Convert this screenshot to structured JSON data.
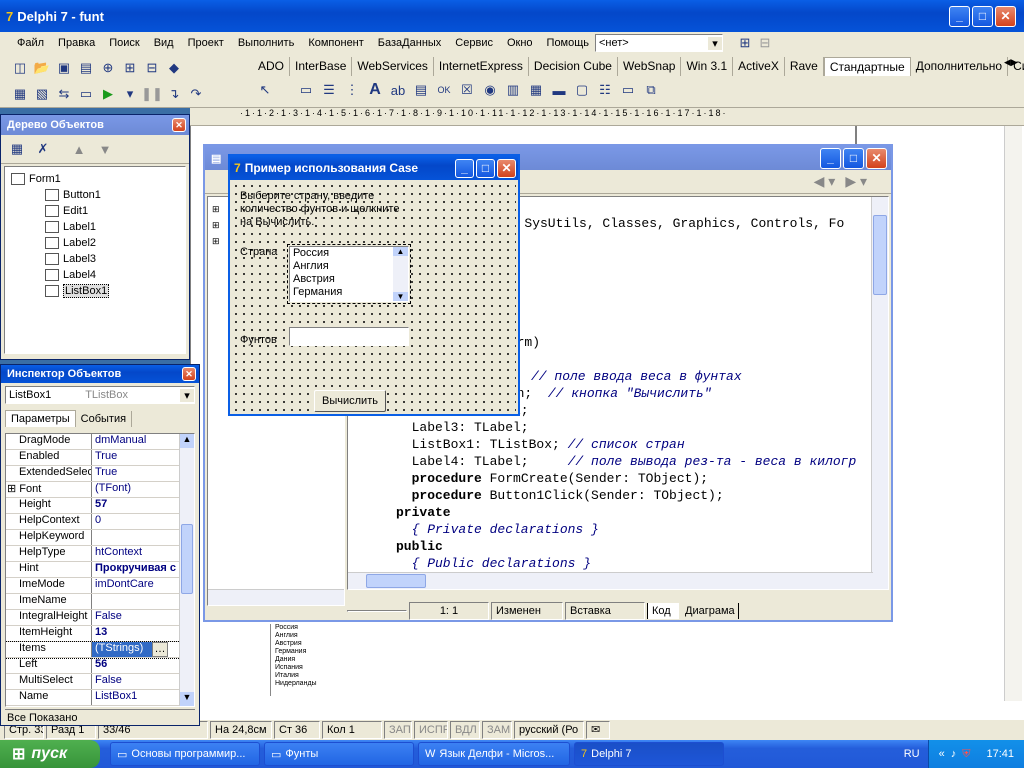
{
  "main_window": {
    "title": "Delphi 7 - funt"
  },
  "menu": [
    "Файл",
    "Правка",
    "Поиск",
    "Вид",
    "Проект",
    "Выполнить",
    "Компонент",
    "БазаДанных",
    "Сервис",
    "Окно",
    "Помощь"
  ],
  "config_combo": "<нет>",
  "palette_tabs": [
    "ADO",
    "InterBase",
    "WebServices",
    "InternetExpress",
    "Decision Cube",
    "WebSnap",
    "Win 3.1",
    "ActiveX",
    "Rave",
    "Стандартные",
    "Дополнительно",
    "Си"
  ],
  "palette_active": "Стандартные",
  "tree_view": {
    "title": "Дерево Объектов",
    "root": "Form1",
    "items": [
      "Button1",
      "Edit1",
      "Label1",
      "Label2",
      "Label3",
      "Label4",
      "ListBox1"
    ]
  },
  "inspector": {
    "title": "Инспектор Объектов",
    "object": "ListBox1",
    "object_type": "TListBox",
    "tab_props": "Параметры",
    "tab_events": "События",
    "props": [
      {
        "n": "DragMode",
        "v": "dmManual"
      },
      {
        "n": "Enabled",
        "v": "True"
      },
      {
        "n": "ExtendedSelec",
        "v": "True"
      },
      {
        "n": "Font",
        "v": "(TFont)"
      },
      {
        "n": "Height",
        "v": "57"
      },
      {
        "n": "HelpContext",
        "v": "0"
      },
      {
        "n": "HelpKeyword",
        "v": ""
      },
      {
        "n": "HelpType",
        "v": "htContext"
      },
      {
        "n": "Hint",
        "v": "Прокручивая с"
      },
      {
        "n": "ImeMode",
        "v": "imDontCare"
      },
      {
        "n": "ImeName",
        "v": ""
      },
      {
        "n": "IntegralHeight",
        "v": "False"
      },
      {
        "n": "ItemHeight",
        "v": "13"
      },
      {
        "n": "Items",
        "v": "(TStrings)"
      },
      {
        "n": "Left",
        "v": "56"
      },
      {
        "n": "MultiSelect",
        "v": "False"
      },
      {
        "n": "Name",
        "v": "ListBox1"
      }
    ],
    "status": "Все Показано"
  },
  "form": {
    "title": "Пример использования Case",
    "instruction": "Выберите страну, введите количество фунтов и щелкните на Вычислить.",
    "label_country": "Страна",
    "countries": [
      "Россия",
      "Англия",
      "Австрия",
      "Германия"
    ],
    "label_pounds": "Фунтов",
    "button": "Вычислить"
  },
  "editor": {
    "code": [
      [
        {
          "t": "s, SysUtils, Classes, Graphics, Controls, Fo",
          "c": "n",
          "indent": "                  "
        }
      ],
      [
        {
          "t": "Form)",
          "c": "n",
          "indent": "                  "
        }
      ],
      [
        {
          "t": ";",
          "c": "n",
          "indent": "                  "
        }
      ],
      [
        {
          "t": "// поле ввода веса в фунтах",
          "c": "c",
          "indent": "                      "
        }
      ],
      [
        {
          "t": "ton;  ",
          "c": "n",
          "indent": "                  "
        },
        {
          "t": "// кнопка \"Вычислить\"",
          "c": "c",
          "indent": ""
        }
      ],
      [
        {
          "t": "Label1: TLabel;",
          "c": "n",
          "indent": "  "
        }
      ],
      [
        {
          "t": "Label3: TLabel;",
          "c": "n",
          "indent": "  "
        }
      ],
      [
        {
          "t": "ListBox1: TListBox; ",
          "c": "n",
          "indent": "  "
        },
        {
          "t": "// список стран",
          "c": "c",
          "indent": ""
        }
      ],
      [
        {
          "t": "Label4: TLabel;     ",
          "c": "n",
          "indent": "  "
        },
        {
          "t": "// поле вывода рез-та - веса в килогр",
          "c": "c",
          "indent": ""
        }
      ],
      [
        {
          "t": "procedure",
          "c": "k",
          "indent": "  "
        },
        {
          "t": " FormCreate(Sender: TObject);",
          "c": "n",
          "indent": ""
        }
      ],
      [
        {
          "t": "procedure",
          "c": "k",
          "indent": "  "
        },
        {
          "t": " Button1Click(Sender: TObject);",
          "c": "n",
          "indent": ""
        }
      ],
      [
        {
          "t": "private",
          "c": "k",
          "indent": ""
        }
      ],
      [
        {
          "t": "{ Private declarations }",
          "c": "c",
          "indent": "  "
        }
      ],
      [
        {
          "t": "public",
          "c": "k",
          "indent": ""
        }
      ],
      [
        {
          "t": "{ Public declarations }",
          "c": "c",
          "indent": "  "
        }
      ]
    ],
    "status_pos": "1:  1",
    "status_mod": "Изменен",
    "status_ins": "Вставка",
    "tab_code": "Код",
    "tab_diagram": "Диаграма"
  },
  "doc_status": [
    "Стр. 33",
    "Разд 1",
    "33/46",
    "На 24,8см",
    "Ст 36",
    "Кол 1",
    "ЗАП",
    "ИСПР",
    "ВДЛ",
    "ЗАМ",
    "русский (Ро"
  ],
  "doc_list": [
    "Россия",
    "Англия",
    "Австрия",
    "Германия",
    "Дания",
    "Испания",
    "Италия",
    "Нидерланды"
  ],
  "taskbar": {
    "start": "пуск",
    "items": [
      "Основы программир...",
      "Фунты",
      "Язык Делфи - Micros...",
      "Delphi 7"
    ],
    "lang": "RU",
    "clock": "17:41"
  }
}
